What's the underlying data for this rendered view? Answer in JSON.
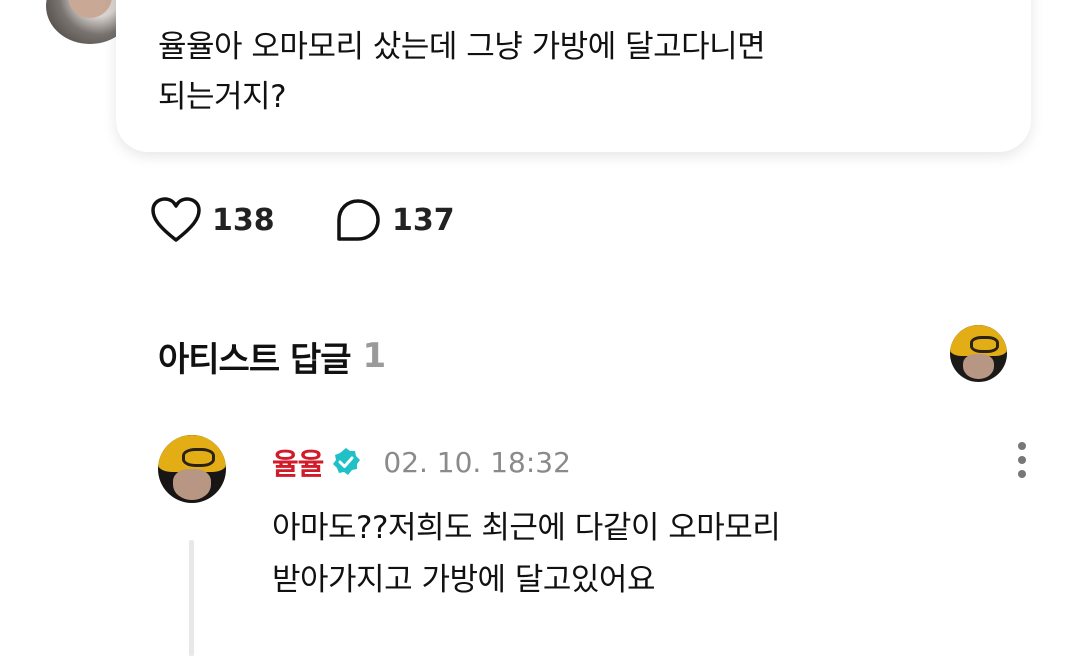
{
  "post": {
    "text_line1": "율율아 오마모리 샀는데 그냥 가방에 달고다니면",
    "text_line2": "되는거지?"
  },
  "actions": {
    "like_count": "138",
    "comment_count": "137"
  },
  "artist_replies": {
    "title": "아티스트 답글",
    "count": "1"
  },
  "reply": {
    "author": "율율",
    "date": "02. 10. 18:32",
    "text_line1": "아마도??저희도 최근에 다같이 오마모리",
    "text_line2": "받아가지고 가방에 달고있어요"
  },
  "colors": {
    "author_name": "#d11a2a",
    "verified_badge": "#1fc0c8",
    "count_muted": "#9a9a9a"
  },
  "icons": {
    "like": "heart-outline-icon",
    "comment": "speech-bubble-icon",
    "verified": "verified-badge-icon",
    "more": "more-vertical-icon"
  }
}
